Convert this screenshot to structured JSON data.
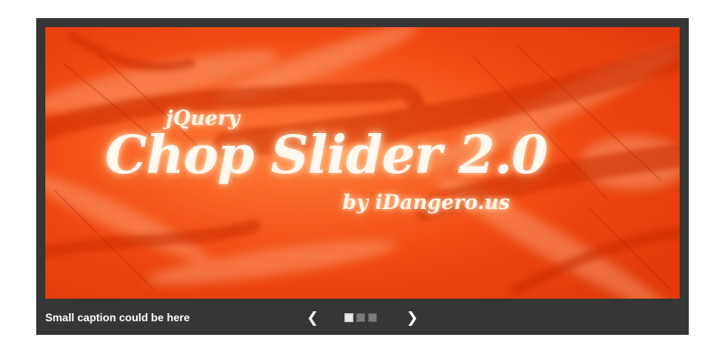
{
  "slider": {
    "current_slide": 1,
    "slide_count": 3,
    "prev_glyph": "❮",
    "next_glyph": "❯",
    "caption": "Small caption could be here",
    "slide": {
      "small_top": "jQuery",
      "title": "Chop Slider 2.0",
      "byline": "by iDangero.us",
      "background_color": "#f04a12"
    },
    "colors": {
      "frame": "#363636",
      "pager_active": "#e8e8e8",
      "pager_inactive": "#7a7a7a"
    }
  }
}
